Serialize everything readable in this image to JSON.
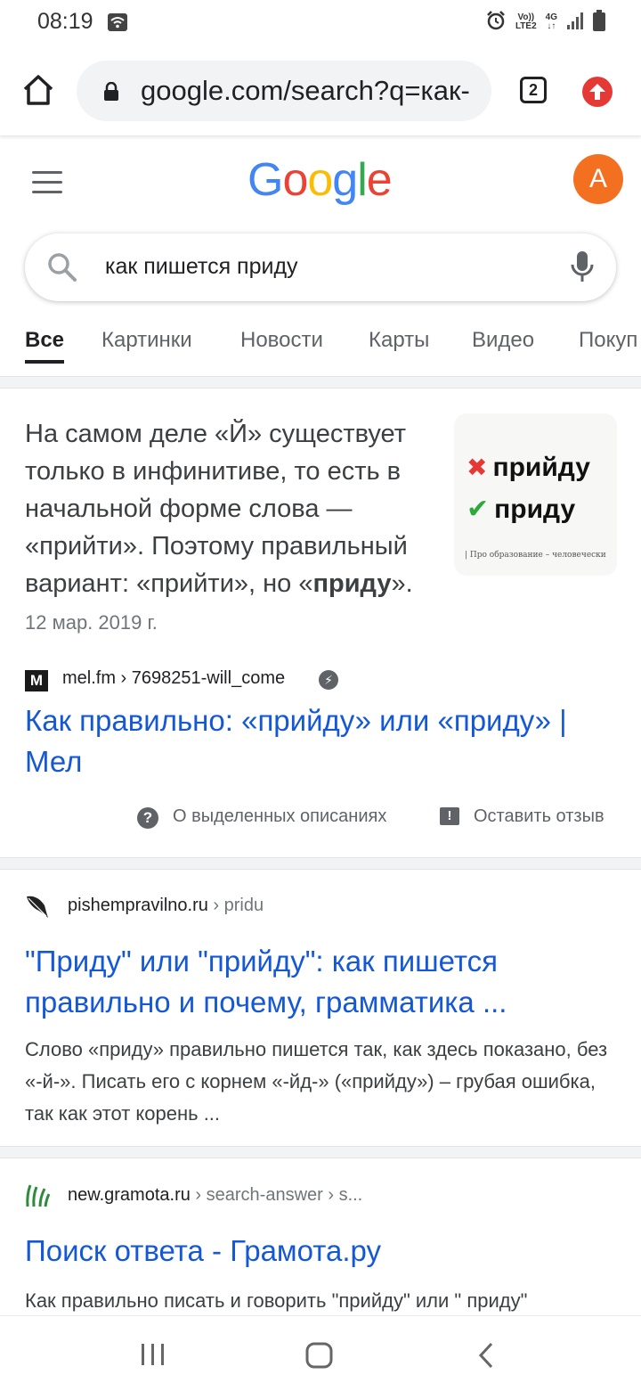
{
  "status": {
    "time": "08:19",
    "volte": "Vo))",
    "lte": "LTE2",
    "network": "4G"
  },
  "browser": {
    "url": "google.com/search?q=как-",
    "tab_count": "2"
  },
  "google": {
    "logo": [
      "G",
      "o",
      "o",
      "g",
      "l",
      "e"
    ],
    "logo_colors": [
      "#4285F4",
      "#EA4335",
      "#FBBC05",
      "#4285F4",
      "#34A853",
      "#EA4335"
    ],
    "avatar_letter": "A",
    "search_query": "как пишется приду"
  },
  "tabs": [
    "Все",
    "Картинки",
    "Новости",
    "Карты",
    "Видео",
    "Покуп"
  ],
  "snippet": {
    "text_before": "На самом деле «Й» существует только в инфинитиве, то есть в начальной форме слова — «прийти». Поэтому правильный вариант: «прийти», но «",
    "text_bold": "приду",
    "text_after": "».",
    "date": "12 мар. 2019 г.",
    "image_wrong": "прийду",
    "image_right": "приду",
    "image_caption": "Про образование – человечески",
    "source_logo": "M",
    "source_url": "mel.fm › 7698251-will_come",
    "title": "Как правильно: «прийду» или «приду» | Мел",
    "about_label": "О выделенных описаниях",
    "feedback_label": "Оставить отзыв"
  },
  "results": [
    {
      "site": "pishempravilno.ru",
      "path": " › pridu",
      "title": "\"Приду\" или \"прийду\": как пишется правильно и почему, грамматика ...",
      "desc": "Слово «приду» правильно пишется так, как здесь показано, без «-й-». Писать его с корнем «-йд-» («прийду») – грубая ошибка, так как этот корень ..."
    },
    {
      "site": "new.gramota.ru",
      "path": " › search-answer › s...",
      "title": "Поиск ответа - Грамота.ру",
      "desc": "Как правильно писать и говорить \"прийду\" или \" приду\""
    }
  ]
}
